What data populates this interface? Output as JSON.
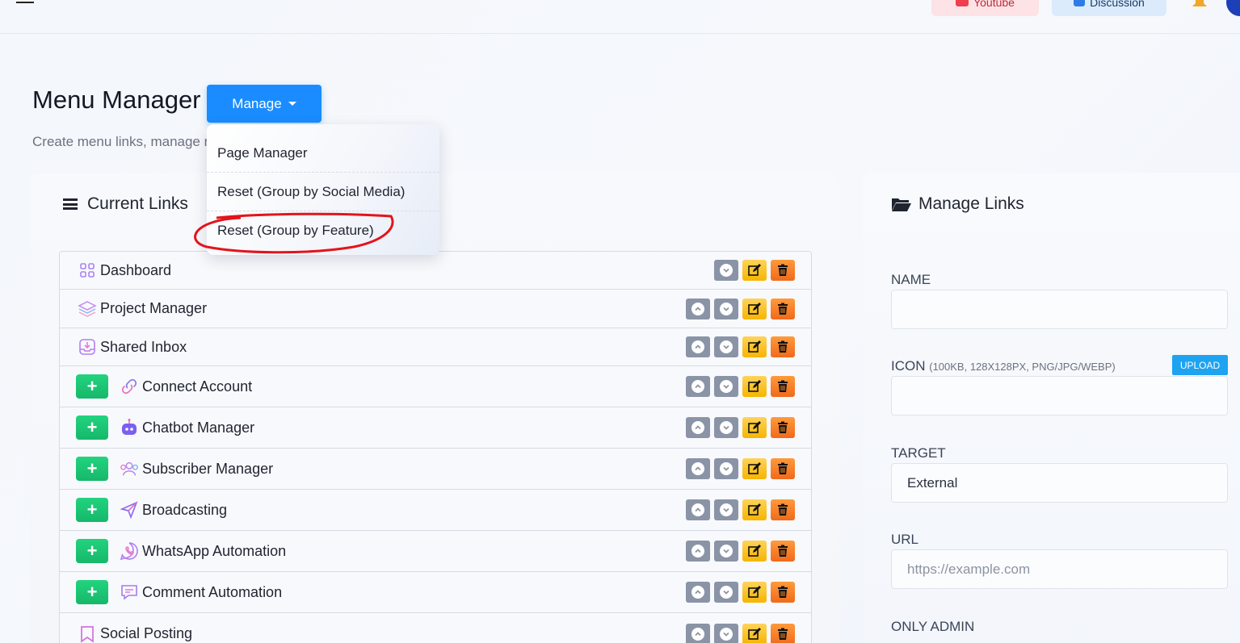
{
  "topbar": {
    "youtube_label": "Youtube",
    "discussion_label": "Discussion"
  },
  "header": {
    "title": "Menu Manager",
    "subtitle": "Create menu links, manage r",
    "manage_label": "Manage"
  },
  "dropdown": {
    "items": [
      {
        "label": "Page Manager"
      },
      {
        "label": "Reset (Group by Social Media)"
      },
      {
        "label": "Reset (Group by Feature)"
      }
    ],
    "highlight_color": "#e3141b"
  },
  "current_links": {
    "title": "Current Links",
    "rows": [
      {
        "label": "Dashboard",
        "icon": "grid-icon",
        "has_plus": false,
        "has_up": false
      },
      {
        "label": "Project Manager",
        "icon": "layers-icon",
        "has_plus": false,
        "has_up": true
      },
      {
        "label": "Shared Inbox",
        "icon": "inbox-icon",
        "has_plus": false,
        "has_up": true
      },
      {
        "label": "Connect Account",
        "icon": "link-icon",
        "has_plus": true,
        "has_up": true
      },
      {
        "label": "Chatbot Manager",
        "icon": "robot-icon",
        "has_plus": true,
        "has_up": true
      },
      {
        "label": "Subscriber Manager",
        "icon": "users-icon",
        "has_plus": true,
        "has_up": true
      },
      {
        "label": "Broadcasting",
        "icon": "send-icon",
        "has_plus": true,
        "has_up": true
      },
      {
        "label": "WhatsApp Automation",
        "icon": "whatsapp-icon",
        "has_plus": true,
        "has_up": true
      },
      {
        "label": "Comment Automation",
        "icon": "comment-icon",
        "has_plus": true,
        "has_up": true
      },
      {
        "label": "Social Posting",
        "icon": "bookmark-icon",
        "has_plus": false,
        "has_up": true
      }
    ]
  },
  "manage_links": {
    "title": "Manage Links",
    "name_label": "NAME",
    "name_value": "",
    "icon_label": "ICON",
    "icon_hint": "(100KB, 128X128PX, PNG/JPG/WEBP)",
    "upload_label": "UPLOAD",
    "icon_value": "",
    "target_label": "TARGET",
    "target_value": "External",
    "url_label": "URL",
    "url_placeholder": "https://example.com",
    "only_admin_label": "ONLY ADMIN"
  },
  "colors": {
    "primary": "#1a8cff",
    "plus_green": "#1ec675",
    "edit_yellow": "#f7b500",
    "delete_orange": "#f06a1c",
    "move_gray": "#8a94a6"
  }
}
